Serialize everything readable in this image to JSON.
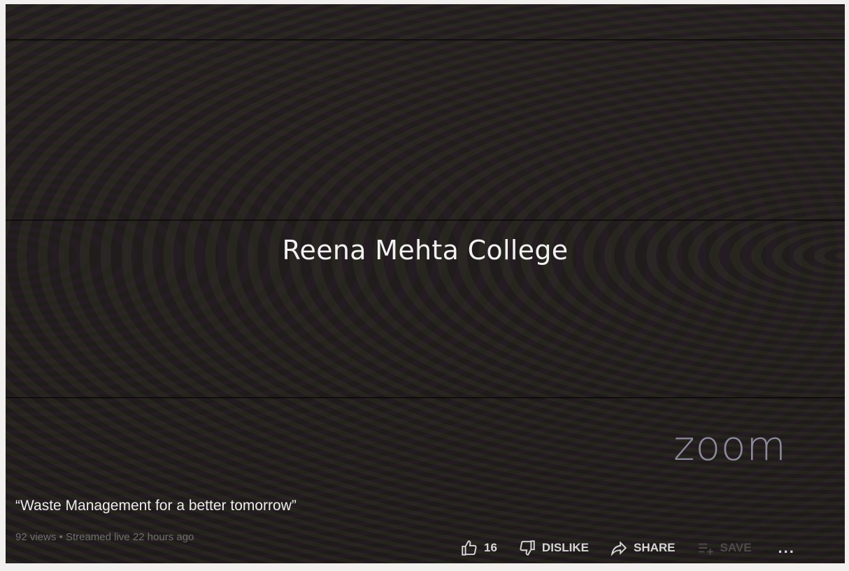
{
  "video": {
    "overlay_text": "Reena Mehta College",
    "watermark": "zoom",
    "title": "“Waste Management for a better tomorrow”",
    "meta": "92 views • Streamed live 22 hours ago"
  },
  "actions": {
    "like_count": "16",
    "dislike_label": "DISLIKE",
    "share_label": "SHARE",
    "save_label": "SAVE",
    "more_label": "..."
  },
  "colors": {
    "background": "#201c1a",
    "zoom_logo": "#8d8a9c",
    "text": "#ececec"
  }
}
